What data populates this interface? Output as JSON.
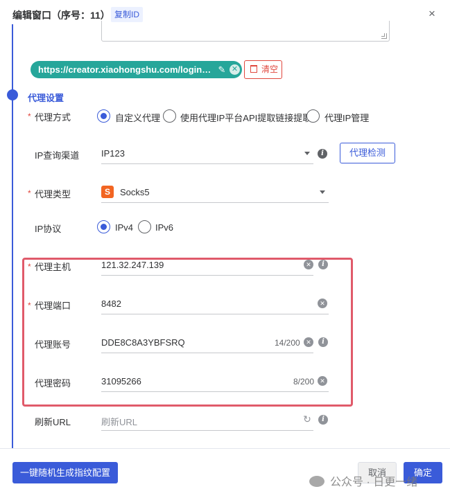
{
  "header": {
    "title": "编辑窗口（序号：11）",
    "copy_id": "复制ID",
    "close": "×"
  },
  "url_chip": {
    "text": "https://creator.xiaohongshu.com/login?so...",
    "clear_label": "清空"
  },
  "section": {
    "title": "代理设置"
  },
  "proxy_method": {
    "label": "代理方式",
    "options": [
      "自定义代理",
      "使用代理IP平台API提取链接提取",
      "代理IP管理"
    ],
    "selected": "自定义代理"
  },
  "ip_channel": {
    "label": "IP查询渠道",
    "value": "IP123",
    "check_button": "代理检测"
  },
  "proxy_type": {
    "label": "代理类型",
    "value": "Socks5",
    "badge": "S"
  },
  "ip_protocol": {
    "label": "IP协议",
    "options": [
      "IPv4",
      "IPv6"
    ],
    "selected": "IPv4"
  },
  "proxy_host": {
    "label": "代理主机",
    "value": "121.32.247.139"
  },
  "proxy_port": {
    "label": "代理端口",
    "value": "8482"
  },
  "proxy_account": {
    "label": "代理账号",
    "value": "DDE8C8A3YBFSRQ",
    "counter": "14/200"
  },
  "proxy_password": {
    "label": "代理密码",
    "value": "31095266",
    "counter": "8/200"
  },
  "refresh_url": {
    "label": "刷新URL",
    "placeholder": "刷新URL"
  },
  "footer": {
    "generate_button": "一键随机生成指纹配置",
    "cancel_button": "取消",
    "ok_button": "确定",
    "watermark": "公众号 · 日更一绪"
  },
  "colors": {
    "primary": "#3a5bd9",
    "chip": "#26a69a",
    "danger": "#e0463c",
    "highlight": "#e05a6a",
    "socks_badge": "#f26522"
  }
}
